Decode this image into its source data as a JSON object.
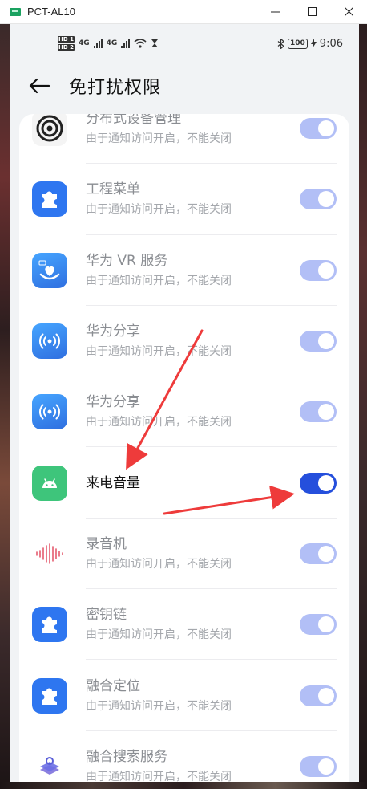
{
  "window": {
    "title": "PCT-AL10",
    "minimize": "—",
    "maximize": "☐",
    "close": "✕"
  },
  "statusbar": {
    "hd1": "HD 1",
    "hd2": "HD 2",
    "net1": "4G",
    "net2": "4G",
    "battery": "100",
    "time": "9:06"
  },
  "header": {
    "title": "免打扰权限"
  },
  "list": [
    {
      "title": "分布式设备管理",
      "subtitle": "由于通知访问开启，不能关闭",
      "icon": "distributed-device-icon",
      "on": false
    },
    {
      "title": "工程菜单",
      "subtitle": "由于通知访问开启，不能关闭",
      "icon": "puzzle-icon",
      "on": false
    },
    {
      "title": "华为 VR 服务",
      "subtitle": "由于通知访问开启，不能关闭",
      "icon": "vr-hand-icon",
      "on": false
    },
    {
      "title": "华为分享",
      "subtitle": "由于通知访问开启，不能关闭",
      "icon": "share-signal-icon",
      "on": false
    },
    {
      "title": "华为分享",
      "subtitle": "由于通知访问开启，不能关闭",
      "icon": "share-signal-icon",
      "on": false
    },
    {
      "title": "来电音量",
      "subtitle": "",
      "icon": "android-icon",
      "on": true
    },
    {
      "title": "录音机",
      "subtitle": "由于通知访问开启，不能关闭",
      "icon": "waveform-icon",
      "on": false
    },
    {
      "title": "密钥链",
      "subtitle": "由于通知访问开启，不能关闭",
      "icon": "puzzle-icon",
      "on": false
    },
    {
      "title": "融合定位",
      "subtitle": "由于通知访问开启，不能关闭",
      "icon": "puzzle-icon",
      "on": false
    },
    {
      "title": "融合搜索服务",
      "subtitle": "由于通知访问开启，不能关闭",
      "icon": "search-layers-icon",
      "on": false
    }
  ],
  "colors": {
    "accent": "#254fdc",
    "toggle_disabled": "#b2bff6",
    "annotation_arrow": "#ee3b3b"
  }
}
